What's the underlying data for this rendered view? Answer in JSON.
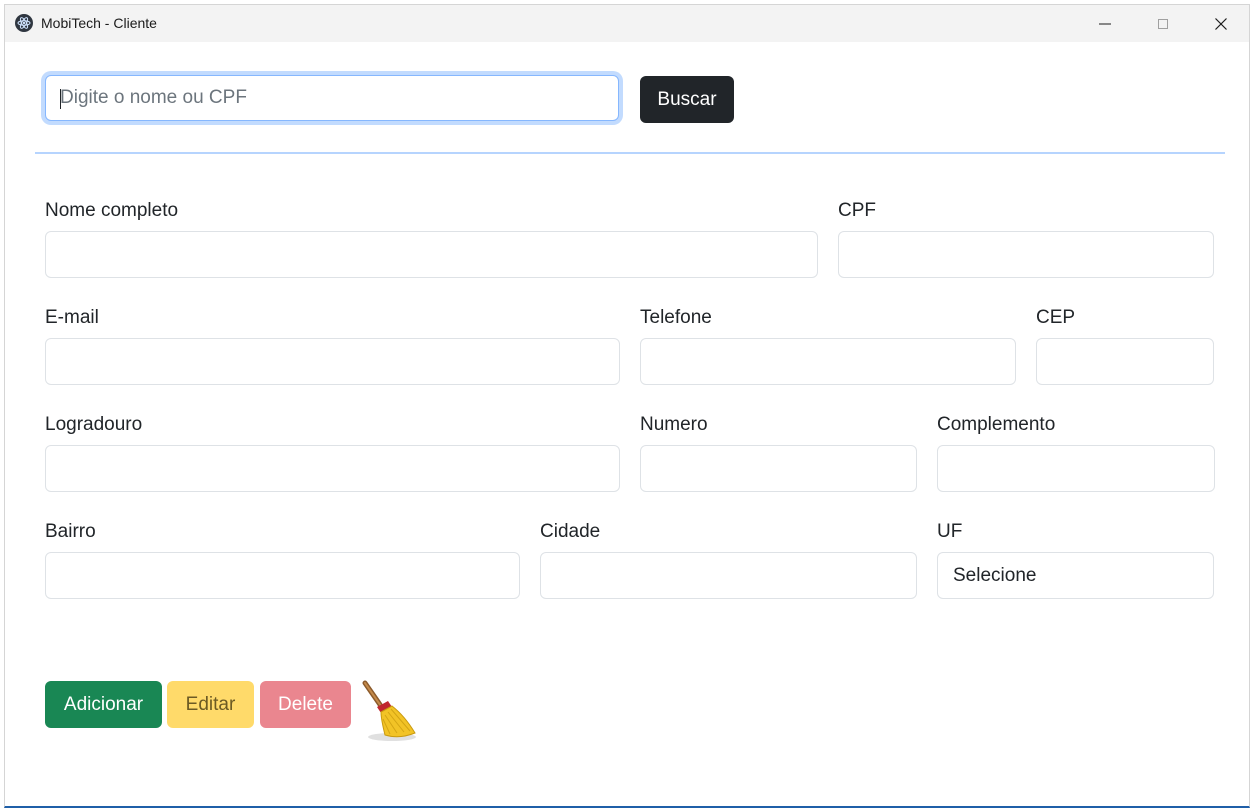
{
  "window": {
    "title": "MobiTech - Cliente",
    "controls": {
      "minimize": "—",
      "maximize": "□",
      "close": "✕"
    }
  },
  "search": {
    "placeholder": "Digite o nome ou CPF",
    "value": "",
    "button_label": "Buscar"
  },
  "form": {
    "nome": {
      "label": "Nome completo",
      "value": ""
    },
    "cpf": {
      "label": "CPF",
      "value": ""
    },
    "email": {
      "label": "E-mail",
      "value": ""
    },
    "telefone": {
      "label": "Telefone",
      "value": ""
    },
    "cep": {
      "label": "CEP",
      "value": ""
    },
    "logradouro": {
      "label": "Logradouro",
      "value": ""
    },
    "numero": {
      "label": "Numero",
      "value": ""
    },
    "complemento": {
      "label": "Complemento",
      "value": ""
    },
    "bairro": {
      "label": "Bairro",
      "value": ""
    },
    "cidade": {
      "label": "Cidade",
      "value": ""
    },
    "uf": {
      "label": "UF",
      "selected": "Selecione"
    }
  },
  "actions": {
    "add_label": "Adicionar",
    "edit_label": "Editar",
    "delete_label": "Delete",
    "clear_icon": "broom-icon"
  },
  "colors": {
    "primary_dark": "#212529",
    "success": "#198754",
    "warning": "#ffda6a",
    "danger": "#ea868f",
    "focus_border": "#86b7fe"
  }
}
